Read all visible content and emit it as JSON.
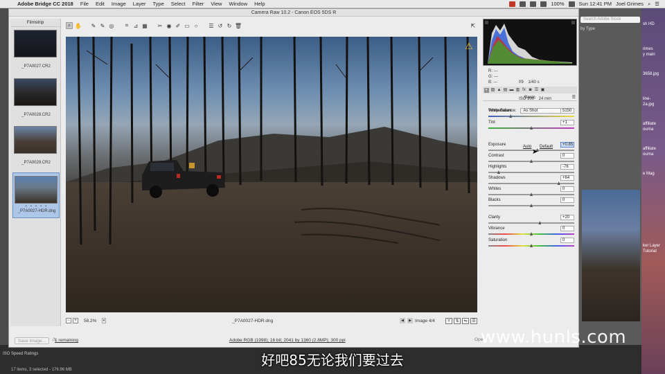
{
  "menubar": {
    "app": "Adobe Bridge CC 2018",
    "items": [
      "File",
      "Edit",
      "Image",
      "Layer",
      "Type",
      "Select",
      "Filter",
      "View",
      "Window",
      "Help"
    ],
    "battery": "100%",
    "clock": "Sun 12:41 PM",
    "user": "Joel Grimes"
  },
  "dialog": {
    "title": "Camera Raw 10.2  -  Canon EOS 5DS R"
  },
  "filmstrip": {
    "title": "Filmstrip",
    "items": [
      {
        "name": "_P7A0027.CR2",
        "selected": false
      },
      {
        "name": "_P7A0028.CR2",
        "selected": false
      },
      {
        "name": "_P7A0029.CR2",
        "selected": false
      },
      {
        "name": "_P7A0027-HDR.dng",
        "selected": true
      }
    ],
    "stars": "• • • • •"
  },
  "preview_footer": {
    "zoom": "58.2%",
    "filename": "_P7A0027-HDR.dng",
    "image_counter": "Image 4/4"
  },
  "histogram_info": {
    "r": "R:   ---",
    "g": "G:   ---",
    "b": "B:   ---",
    "exif_line1": "f/9    1/40 s",
    "exif_line2": "ISO 100    24 mm"
  },
  "basic_panel": {
    "title": "Basic",
    "white_balance_label": "White Balance:",
    "white_balance_value": "As Shot",
    "auto": "Auto",
    "default": "Default",
    "sliders": [
      {
        "id": "temperature",
        "label": "Temperature",
        "value": "5150",
        "fraction": 0.26,
        "track": "temp"
      },
      {
        "id": "tint",
        "label": "Tint",
        "value": "+1",
        "fraction": 0.5,
        "track": "tint"
      },
      {
        "id": "exposure",
        "label": "Exposure",
        "value": "+0.85",
        "fraction": 0.57,
        "track": "plain",
        "focus": true
      },
      {
        "id": "contrast",
        "label": "Contrast",
        "value": "0",
        "fraction": 0.5,
        "track": "plain"
      },
      {
        "id": "highlights",
        "label": "Highlights",
        "value": "-76",
        "fraction": 0.12,
        "track": "plain"
      },
      {
        "id": "shadows",
        "label": "Shadows",
        "value": "+64",
        "fraction": 0.82,
        "track": "plain"
      },
      {
        "id": "whites",
        "label": "Whites",
        "value": "0",
        "fraction": 0.5,
        "track": "plain"
      },
      {
        "id": "blacks",
        "label": "Blacks",
        "value": "0",
        "fraction": 0.5,
        "track": "plain"
      },
      {
        "id": "clarity",
        "label": "Clarity",
        "value": "+20",
        "fraction": 0.6,
        "track": "plain"
      },
      {
        "id": "vibrance",
        "label": "Vibrance",
        "value": "0",
        "fraction": 0.5,
        "track": "sat"
      },
      {
        "id": "saturation",
        "label": "Saturation",
        "value": "0",
        "fraction": 0.5,
        "track": "sat"
      }
    ]
  },
  "dialog_bottom": {
    "save": "Save Image...",
    "remaining": "1 remaining",
    "workflow": "Adobe RGB (1998); 16 bit; 2041 by 1360 (2.8MP); 300 ppi",
    "open": "Ope"
  },
  "bridge": {
    "search_placeholder": "Search Adobe Stock",
    "sort": "by Type",
    "metadata_row": "ISO Speed Ratings",
    "status": "17 items, 3 selected - 176.96 MB"
  },
  "desktop_labels": [
    "sh HD",
    "rimes",
    "y main",
    "3658.jpg",
    "line-",
    "2a.jpg",
    "affiliate",
    "ourna",
    "affiliate",
    "ourna",
    "e Mag",
    "ker Layer",
    "Tutorial"
  ],
  "overlay": {
    "watermark": "www.hunls.com",
    "subtitle": "好吧85无论我们要过去"
  },
  "colors": {
    "dialog_bg": "#ececec",
    "selection": "#aec7e8",
    "focus_field": "#c9dbf6"
  }
}
